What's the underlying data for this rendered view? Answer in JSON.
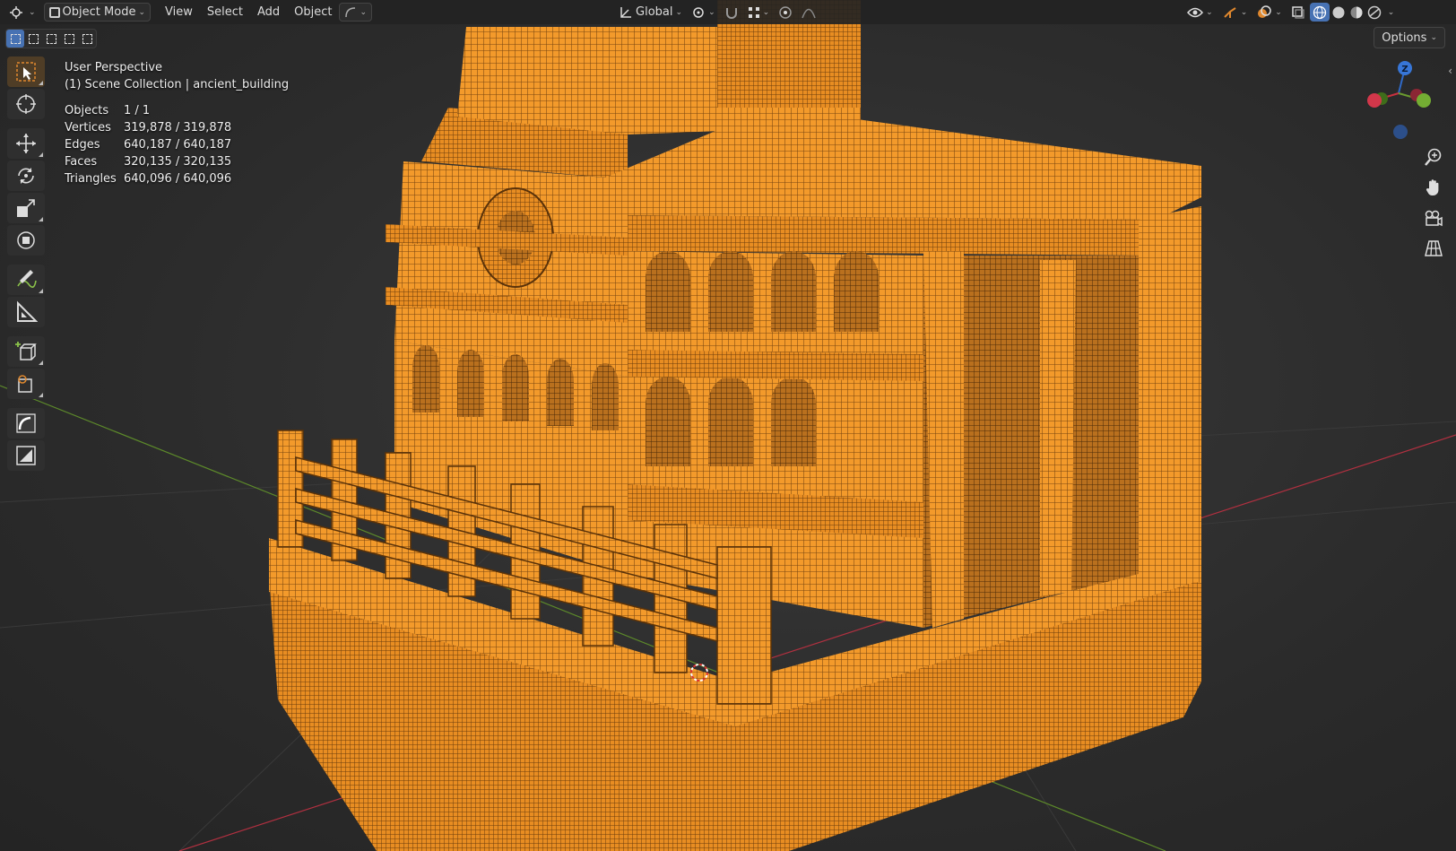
{
  "header": {
    "mode_label": "Object Mode",
    "menus": [
      "View",
      "Select",
      "Add",
      "Object"
    ],
    "transform_orientation": "Global"
  },
  "options_label": "Options",
  "overlay": {
    "perspective": "User Perspective",
    "collection": "(1) Scene Collection | ancient_building",
    "stats": [
      {
        "label": "Objects",
        "value": "1 / 1"
      },
      {
        "label": "Vertices",
        "value": "319,878 / 319,878"
      },
      {
        "label": "Edges",
        "value": "640,187 / 640,187"
      },
      {
        "label": "Faces",
        "value": "320,135 / 320,135"
      },
      {
        "label": "Triangles",
        "value": "640,096 / 640,096"
      }
    ]
  },
  "gizmo": {
    "z_label": "Z"
  },
  "colors": {
    "wire": "#f39a2b",
    "wire_dark": "#6b3d0c",
    "accent": "#4772b3",
    "active_tool": "#e0882e",
    "axis_x": "#c7313f",
    "axis_y": "#6a9a2f",
    "axis_z": "#2f69c7"
  },
  "icons": {
    "tools": [
      "select-box-icon",
      "cursor-icon",
      "move-icon",
      "rotate-icon",
      "scale-icon",
      "transform-icon",
      "annotate-icon",
      "measure-icon",
      "add-cube-icon",
      "add-object-icon",
      "curve-icon",
      "image-icon"
    ],
    "nav": [
      "zoom-icon",
      "hand-pan-icon",
      "camera-icon",
      "grid-ortho-icon"
    ]
  }
}
